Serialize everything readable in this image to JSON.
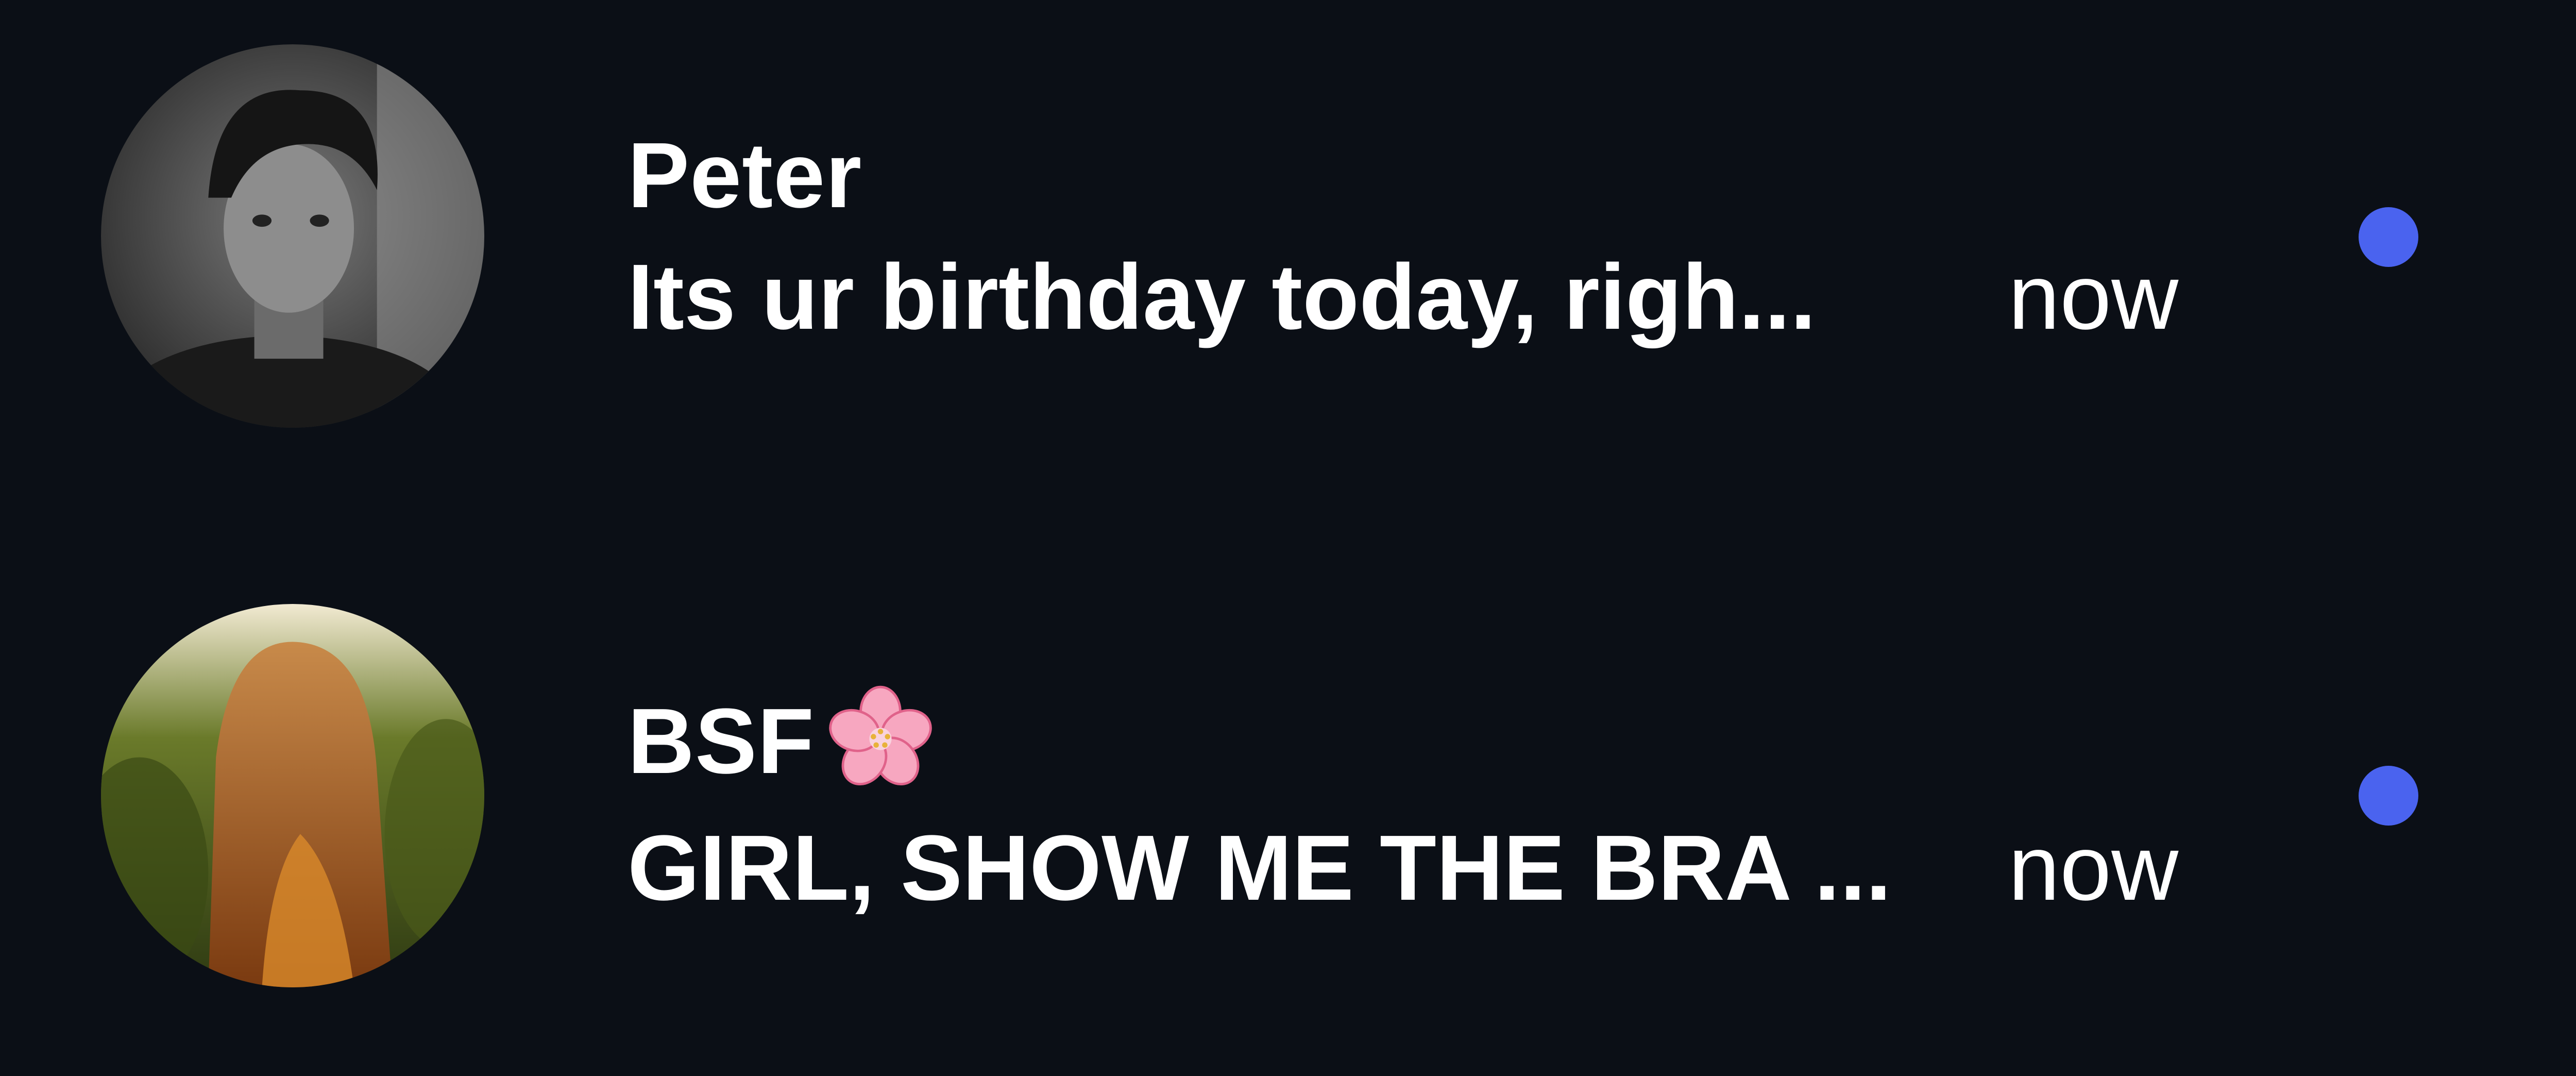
{
  "colors": {
    "background": "#0b0f16",
    "text": "#ffffff",
    "unread_dot": "#4a63ef"
  },
  "threads": [
    {
      "name": "Peter",
      "name_icon": "",
      "preview": "Its ur birthday today, righ...",
      "timestamp": "now",
      "unread": true,
      "avatar": "avatar-photo-grayscale-person"
    },
    {
      "name": "BSF",
      "name_icon": "cherry-blossom-icon",
      "preview": "GIRL, SHOW ME THE BRA ...",
      "timestamp": "now",
      "unread": true,
      "avatar": "avatar-photo-long-hair-sunset"
    }
  ]
}
